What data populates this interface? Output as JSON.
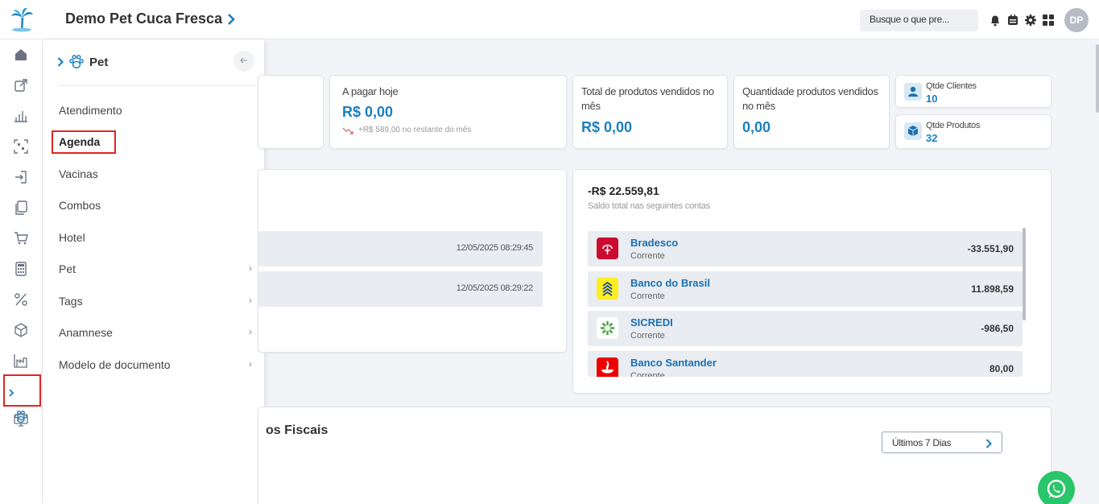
{
  "header": {
    "company": "Demo Pet Cuca Fresca",
    "search_placeholder": "Busque o que pre...",
    "avatar_initials": "DP"
  },
  "panel": {
    "title": "Pet",
    "items": [
      {
        "label": "Atendimento",
        "has_arrow": false
      },
      {
        "label": "Agenda",
        "has_arrow": false,
        "highlighted": true
      },
      {
        "label": "Vacinas",
        "has_arrow": false
      },
      {
        "label": "Combos",
        "has_arrow": false
      },
      {
        "label": "Hotel",
        "has_arrow": false
      },
      {
        "label": "Pet",
        "has_arrow": true
      },
      {
        "label": "Tags",
        "has_arrow": true
      },
      {
        "label": "Anamnese",
        "has_arrow": true
      },
      {
        "label": "Modelo de documento",
        "has_arrow": true
      }
    ]
  },
  "cards": {
    "pagar_hoje": {
      "label": "A pagar hoje",
      "value": "R$ 0,00",
      "sub": "+R$ 589,00 no restante do mês"
    },
    "produtos_vendidos": {
      "label": "Total de produtos vendidos no mês",
      "value": "R$ 0,00"
    },
    "quantidade_vendidos": {
      "label": "Quantidade produtos vendidos no mês",
      "value": "0,00"
    },
    "qtde_clientes": {
      "label": "Qtde Clientes",
      "value": "10"
    },
    "qtde_produtos": {
      "label": "Qtde Produtos",
      "value": "32"
    }
  },
  "activity": {
    "rows": [
      {
        "timestamp": "12/05/2025 08:29:45"
      },
      {
        "timestamp": "12/05/2025 08:29:22"
      }
    ]
  },
  "saldo": {
    "total": "-R$ 22.559,81",
    "subtitle": "Saldo total nas seguintes contas",
    "banks": [
      {
        "name": "Bradesco",
        "type": "Corrente",
        "value": "-33.551,90",
        "color": "#cc092f"
      },
      {
        "name": "Banco do Brasil",
        "type": "Corrente",
        "value": "11.898,59",
        "color": "#fcee21"
      },
      {
        "name": "SICREDI",
        "type": "Corrente",
        "value": "-986,50",
        "color": "#ffffff"
      },
      {
        "name": "Banco Santander",
        "type": "Corrente",
        "value": "80,00",
        "color": "#ec0000"
      }
    ]
  },
  "fiscais": {
    "title_fragment": "os Fiscais",
    "period": "Últimos 7 Dias"
  },
  "colors": {
    "accent": "#1a7fc1",
    "highlight": "#e02424"
  }
}
